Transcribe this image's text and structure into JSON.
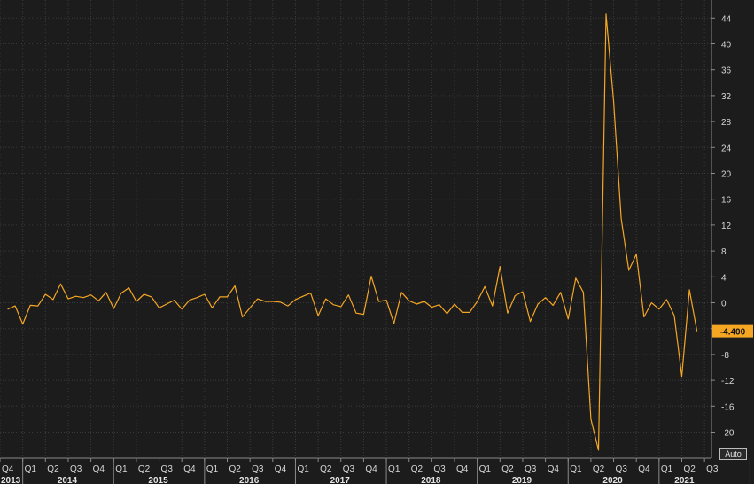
{
  "chart_data": {
    "type": "line",
    "title": "",
    "xlabel": "",
    "ylabel": "",
    "frequency": "monthly",
    "x_start": "2013-11",
    "ylim": [
      -23.5,
      46
    ],
    "yticks": [
      -20,
      -16,
      -12,
      -8,
      -4,
      0,
      4,
      8,
      12,
      16,
      20,
      24,
      28,
      32,
      36,
      40,
      44
    ],
    "quarter_ticks": [
      {
        "date": "2013-10",
        "label": "Q4"
      },
      {
        "date": "2014-01",
        "label": "Q1"
      },
      {
        "date": "2014-04",
        "label": "Q2"
      },
      {
        "date": "2014-07",
        "label": "Q3"
      },
      {
        "date": "2014-10",
        "label": "Q4"
      },
      {
        "date": "2015-01",
        "label": "Q1"
      },
      {
        "date": "2015-04",
        "label": "Q2"
      },
      {
        "date": "2015-07",
        "label": "Q3"
      },
      {
        "date": "2015-10",
        "label": "Q4"
      },
      {
        "date": "2016-01",
        "label": "Q1"
      },
      {
        "date": "2016-04",
        "label": "Q2"
      },
      {
        "date": "2016-07",
        "label": "Q3"
      },
      {
        "date": "2016-10",
        "label": "Q4"
      },
      {
        "date": "2017-01",
        "label": "Q1"
      },
      {
        "date": "2017-04",
        "label": "Q2"
      },
      {
        "date": "2017-07",
        "label": "Q3"
      },
      {
        "date": "2017-10",
        "label": "Q4"
      },
      {
        "date": "2018-01",
        "label": "Q1"
      },
      {
        "date": "2018-04",
        "label": "Q2"
      },
      {
        "date": "2018-07",
        "label": "Q3"
      },
      {
        "date": "2018-10",
        "label": "Q4"
      },
      {
        "date": "2019-01",
        "label": "Q1"
      },
      {
        "date": "2019-04",
        "label": "Q2"
      },
      {
        "date": "2019-07",
        "label": "Q3"
      },
      {
        "date": "2019-10",
        "label": "Q4"
      },
      {
        "date": "2020-01",
        "label": "Q1"
      },
      {
        "date": "2020-04",
        "label": "Q2"
      },
      {
        "date": "2020-07",
        "label": "Q3"
      },
      {
        "date": "2020-10",
        "label": "Q4"
      },
      {
        "date": "2021-01",
        "label": "Q1"
      },
      {
        "date": "2021-04",
        "label": "Q2"
      },
      {
        "date": "2021-07",
        "label": "Q3"
      }
    ],
    "year_labels": [
      {
        "date": "2013",
        "label": "2013"
      },
      {
        "date": "2014",
        "label": "2014"
      },
      {
        "date": "2015",
        "label": "2015"
      },
      {
        "date": "2016",
        "label": "2016"
      },
      {
        "date": "2017",
        "label": "2017"
      },
      {
        "date": "2018",
        "label": "2018"
      },
      {
        "date": "2019",
        "label": "2019"
      },
      {
        "date": "2020",
        "label": "2020"
      },
      {
        "date": "2021",
        "label": "2021"
      }
    ],
    "grid": true,
    "series": [
      {
        "color": "#f5a623",
        "values": [
          -1.0,
          -0.5,
          -3.3,
          -0.4,
          -0.5,
          1.3,
          0.5,
          2.9,
          0.6,
          1.0,
          0.8,
          1.2,
          0.3,
          1.6,
          -0.9,
          1.5,
          2.3,
          0.2,
          1.3,
          0.9,
          -0.8,
          -0.2,
          0.4,
          -1.0,
          0.4,
          0.8,
          1.3,
          -0.8,
          0.9,
          0.9,
          2.6,
          -2.2,
          -0.8,
          0.6,
          0.2,
          0.2,
          0.1,
          -0.5,
          0.5,
          1.0,
          1.5,
          -2.0,
          0.6,
          -0.3,
          -0.6,
          1.2,
          -1.6,
          -1.8,
          4.1,
          0.2,
          0.4,
          -3.2,
          1.6,
          0.3,
          -0.2,
          0.2,
          -0.7,
          -0.3,
          -1.7,
          -0.2,
          -1.5,
          -1.5,
          0.2,
          2.5,
          -0.5,
          5.6,
          -1.6,
          1.1,
          1.7,
          -2.9,
          -0.2,
          0.8,
          -0.4,
          1.6,
          -2.5,
          3.8,
          1.6,
          -18.0,
          -22.8,
          44.6,
          31.0,
          13.0,
          5.0,
          7.5,
          -2.2,
          0.0,
          -1.0,
          0.5,
          -2.0,
          -11.4,
          2.0,
          -4.4
        ]
      }
    ],
    "last_value_label": "-4.400"
  },
  "controls": {
    "auto_label": "Auto"
  },
  "colors": {
    "background": "#1c1c1c",
    "grid": "#3a3a3a",
    "line": "#f5a623",
    "badge": "#f5a623"
  }
}
